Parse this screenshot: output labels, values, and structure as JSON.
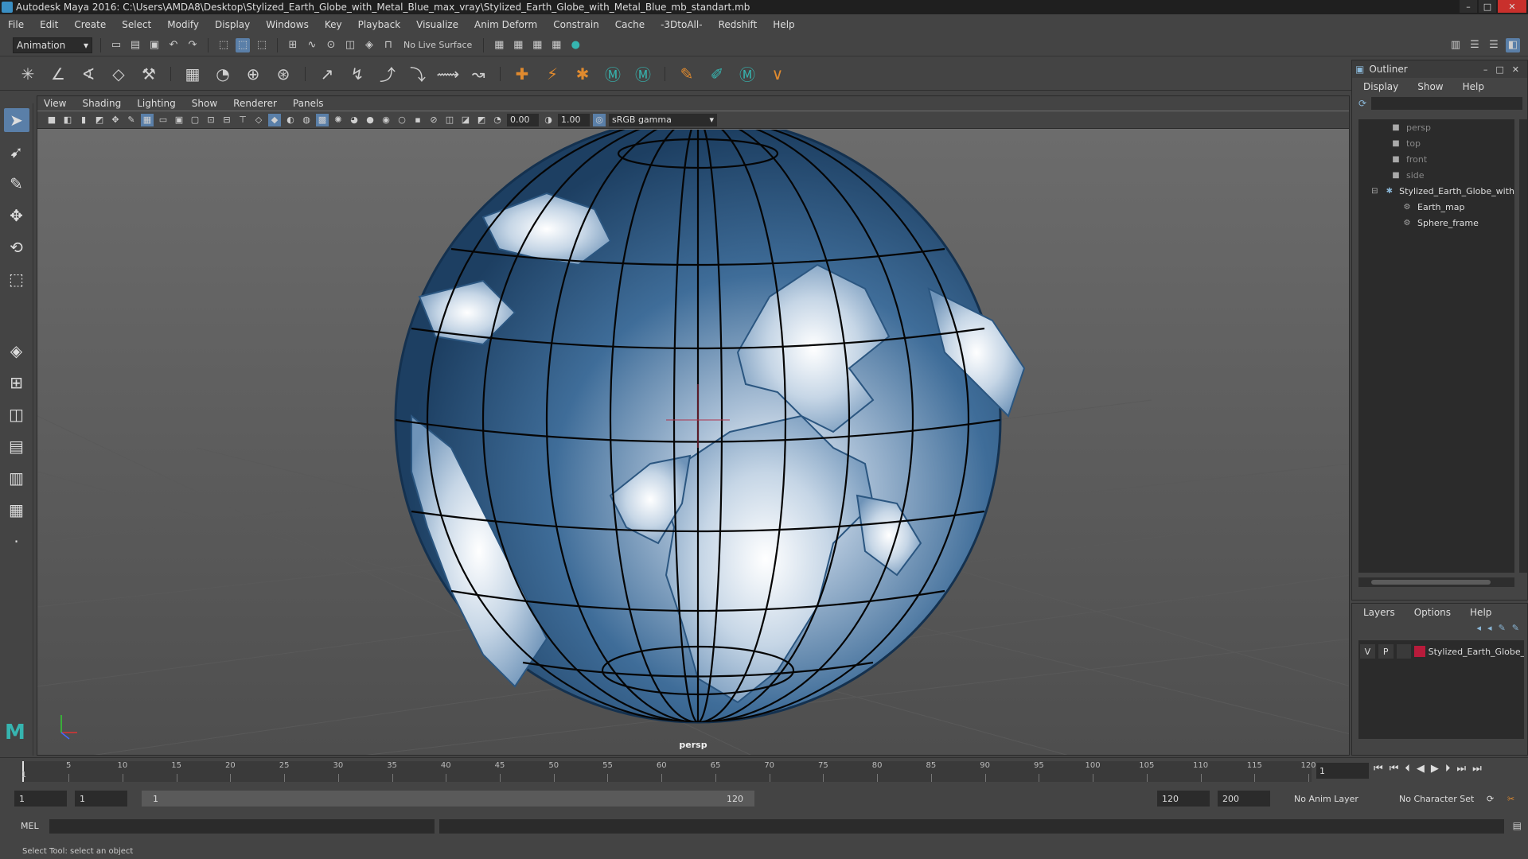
{
  "window": {
    "title": "Autodesk Maya 2016: C:\\Users\\AMDA8\\Desktop\\Stylized_Earth_Globe_with_Metal_Blue_max_vray\\Stylized_Earth_Globe_with_Metal_Blue_mb_standart.mb",
    "min": "–",
    "max": "□",
    "close": "✕"
  },
  "menubar": [
    "File",
    "Edit",
    "Create",
    "Select",
    "Modify",
    "Display",
    "Windows",
    "Key",
    "Playback",
    "Visualize",
    "Anim Deform",
    "Constrain",
    "Cache",
    "-3DtoAll-",
    "Redshift",
    "Help"
  ],
  "statusline": {
    "mode": "Animation",
    "live_surface": "No Live Surface"
  },
  "viewport": {
    "menu": [
      "View",
      "Shading",
      "Lighting",
      "Show",
      "Renderer",
      "Panels"
    ],
    "exposure": "0.00",
    "gamma": "1.00",
    "color_space": "sRGB gamma",
    "camera_label": "persp"
  },
  "outliner": {
    "title": "Outliner",
    "menu": [
      "Display",
      "Show",
      "Help"
    ],
    "items": [
      {
        "label": "persp",
        "icon": "camera-icon",
        "kind": "cam"
      },
      {
        "label": "top",
        "icon": "camera-icon",
        "kind": "cam"
      },
      {
        "label": "front",
        "icon": "camera-icon",
        "kind": "cam"
      },
      {
        "label": "side",
        "icon": "camera-icon",
        "kind": "cam"
      },
      {
        "label": "Stylized_Earth_Globe_with",
        "icon": "group-icon",
        "kind": "group"
      },
      {
        "label": "Earth_map",
        "icon": "mesh-icon",
        "kind": "child"
      },
      {
        "label": "Sphere_frame",
        "icon": "mesh-icon",
        "kind": "child"
      }
    ]
  },
  "layers": {
    "menu": [
      "Layers",
      "Options",
      "Help"
    ],
    "row": {
      "v": "V",
      "p": "P",
      "name": "Stylized_Earth_Globe_v",
      "color": "#b81b3b"
    }
  },
  "timeline": {
    "ticks": [
      "5",
      "10",
      "15",
      "20",
      "25",
      "30",
      "35",
      "40",
      "45",
      "50",
      "55",
      "60",
      "65",
      "70",
      "75",
      "80",
      "85",
      "90",
      "95",
      "100",
      "105",
      "110",
      "115",
      "120"
    ],
    "first_tick": "1",
    "current_frame": "1"
  },
  "range": {
    "start": "1",
    "playback_start": "1",
    "slider_start": "1",
    "slider_end": "120",
    "playback_end": "120",
    "end": "200",
    "anim_layer": "No Anim Layer",
    "char_set": "No Character Set"
  },
  "command": {
    "label": "MEL"
  },
  "help_line": "Select Tool: select an object",
  "colors": {
    "globe_blue": "#2d5a86",
    "accent": "#5a7fa8",
    "maya_teal": "#36b5b0"
  }
}
